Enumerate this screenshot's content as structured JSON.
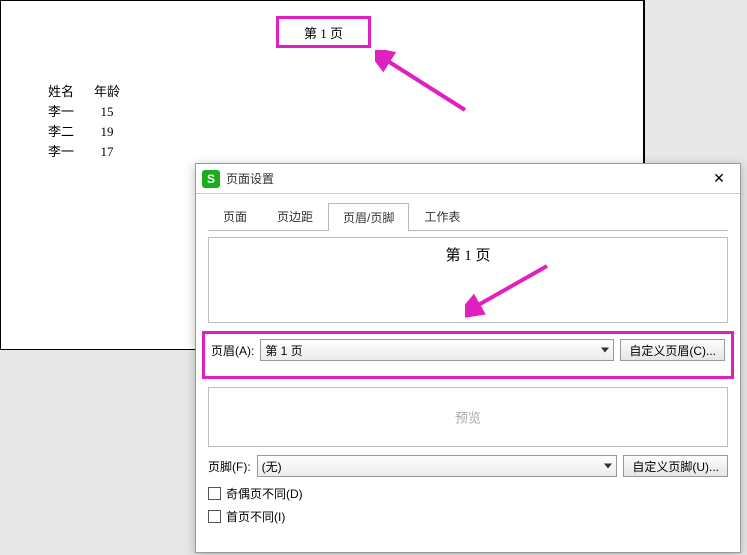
{
  "doc": {
    "header_text": "第 1 页",
    "table": {
      "col_name": "姓名",
      "col_age": "年龄",
      "rows": [
        {
          "name": "李一",
          "age": "15"
        },
        {
          "name": "李二",
          "age": "19"
        },
        {
          "name": "李一",
          "age": "17"
        }
      ]
    }
  },
  "dialog": {
    "title": "页面设置",
    "tabs": {
      "page": "页面",
      "margins": "页边距",
      "headerfooter": "页眉/页脚",
      "sheet": "工作表"
    },
    "header_preview": "第 1 页",
    "header_label": "页眉(A):",
    "header_value": "第 1 页",
    "custom_header_btn": "自定义页眉(C)...",
    "footer_preview_placeholder": "预览",
    "footer_label": "页脚(F):",
    "footer_value": "(无)",
    "custom_footer_btn": "自定义页脚(U)...",
    "oddeven_diff": "奇偶页不同(D)",
    "firstpage_diff": "首页不同(I)"
  }
}
